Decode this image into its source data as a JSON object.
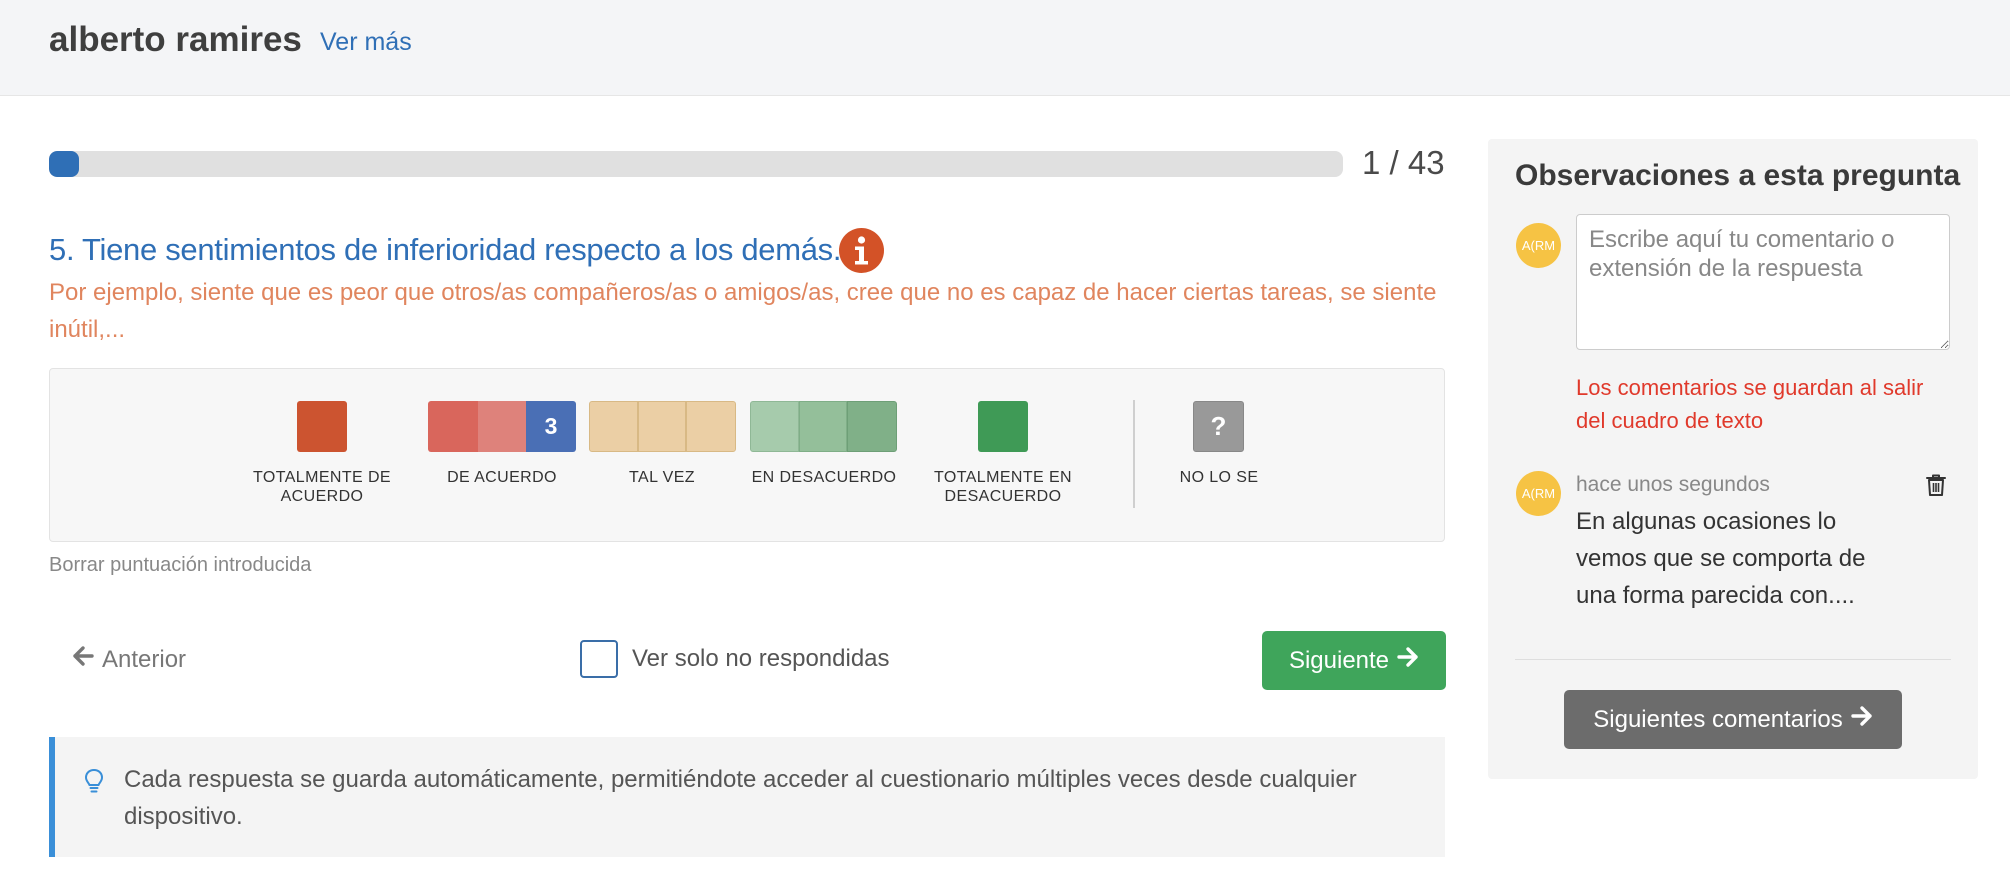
{
  "header": {
    "user_name": "alberto ramires",
    "ver_mas": "Ver más"
  },
  "progress": {
    "current": 1,
    "total": 43,
    "label": "1 / 43",
    "fraction": 0.023
  },
  "question": {
    "title": "5. Tiene sentimientos de inferioridad respecto a los demás.",
    "hint": "Por ejemplo, siente que es peor que otros/as compañeros/as o amigos/as, cree que no es capaz de hacer ciertas tareas, se siente inútil,...",
    "info_icon": "info-icon"
  },
  "scale": {
    "selected_value": "3",
    "options": [
      {
        "label": "TOTALMENTE DE ACUERDO",
        "colors": [
          "#cc5430"
        ]
      },
      {
        "label": "DE ACUERDO",
        "colors": [
          "#d9665c",
          "#de827b",
          "#4a6fb5"
        ]
      },
      {
        "label": "TAL VEZ",
        "colors": [
          "#ebcfa5",
          "#ebcfa5",
          "#ebcfa5"
        ]
      },
      {
        "label": "EN DESACUERDO",
        "colors": [
          "#a6cbac",
          "#94bf9a",
          "#80b088"
        ]
      },
      {
        "label": "TOTALMENTE EN DESACUERDO",
        "colors": [
          "#3f9a56"
        ]
      },
      {
        "label": "NO LO SE",
        "colors": [
          "#999999"
        ],
        "symbol": "?"
      }
    ]
  },
  "actions": {
    "clear": "Borrar puntuación introducida",
    "previous": "Anterior",
    "only_unanswered": "Ver solo no respondidas",
    "next": "Siguiente"
  },
  "notice": {
    "icon": "lightbulb-icon",
    "text": "Cada respuesta se guarda automáticamente, permitiéndote acceder al cuestionario múltiples veces desde cualquier dispositivo."
  },
  "observations": {
    "title": "Observaciones a esta pregunta",
    "avatar_initials": "A(RM",
    "placeholder": "Escribe aquí tu comentario o extensión de la respuesta",
    "warning": "Los comentarios se guardan al salir del cuadro de texto",
    "comments": [
      {
        "time": "hace unos segundos",
        "text": "En algunas ocasiones lo vemos que se comporta de una forma parecida con...."
      }
    ],
    "more_button": "Siguientes comentarios"
  },
  "colors": {
    "primary_blue": "#2f6fb6",
    "hint_orange": "#e0855e",
    "next_green": "#3fa55b",
    "warning_red": "#e0392b",
    "avatar_yellow": "#f6c344"
  }
}
